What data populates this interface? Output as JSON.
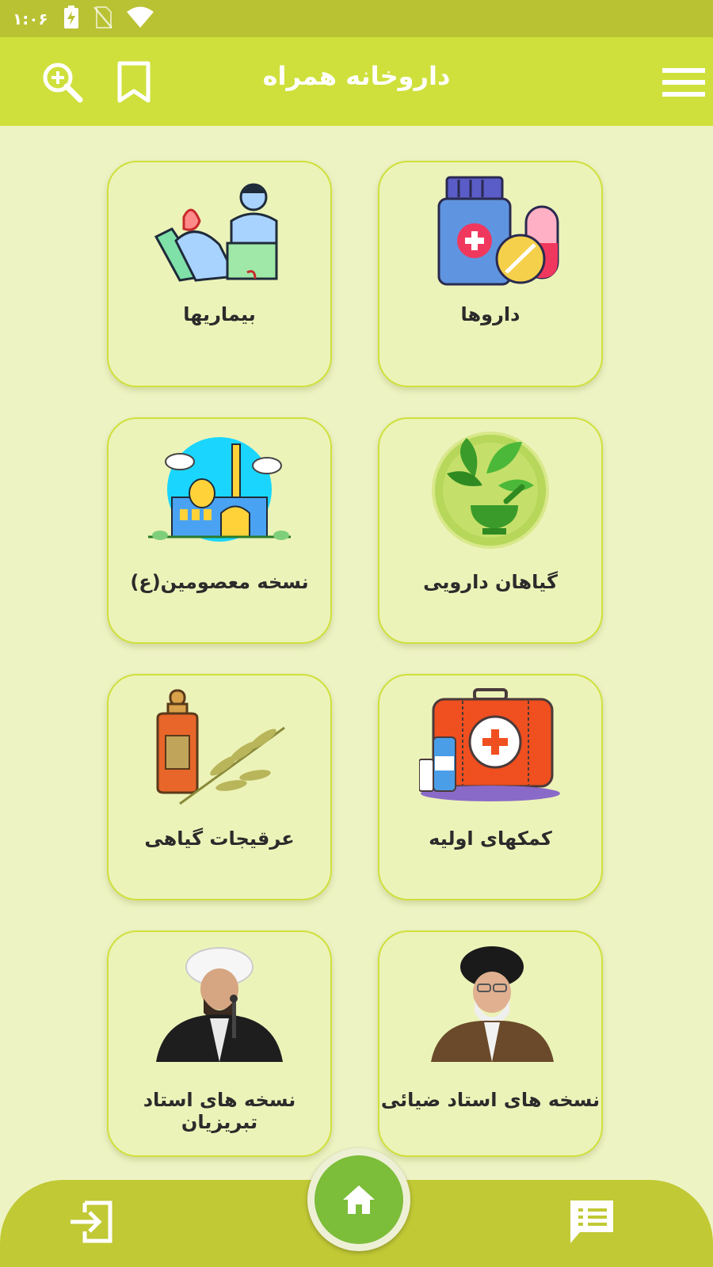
{
  "status_bar": {
    "time": "۱:۰۶"
  },
  "app_bar": {
    "title": "داروخانه همراه"
  },
  "cards": [
    {
      "label": "داروها",
      "icon": "medicine-bottle-pills-icon"
    },
    {
      "label": "بیماریها",
      "icon": "doctor-patient-icon"
    },
    {
      "label": "گیاهان دارویی",
      "icon": "herbal-mortar-icon"
    },
    {
      "label": "نسخه معصومین(ع)",
      "icon": "shrine-icon"
    },
    {
      "label": "کمکهای اولیه",
      "icon": "first-aid-kit-icon"
    },
    {
      "label": "عرقیجات گیاهی",
      "icon": "herbal-extract-bottle-icon"
    },
    {
      "label": "نسخه های استاد ضیائی",
      "icon": "cleric-portrait"
    },
    {
      "label": "نسخه های استاد تبریزیان",
      "icon": "cleric-portrait"
    }
  ],
  "colors": {
    "status_bar": "#b9c232",
    "app_bar": "#cfe03c",
    "background": "#eef3c4",
    "card": "#ecf3b8",
    "bottom_bar": "#c1c935",
    "home": "#7cbd3a"
  }
}
